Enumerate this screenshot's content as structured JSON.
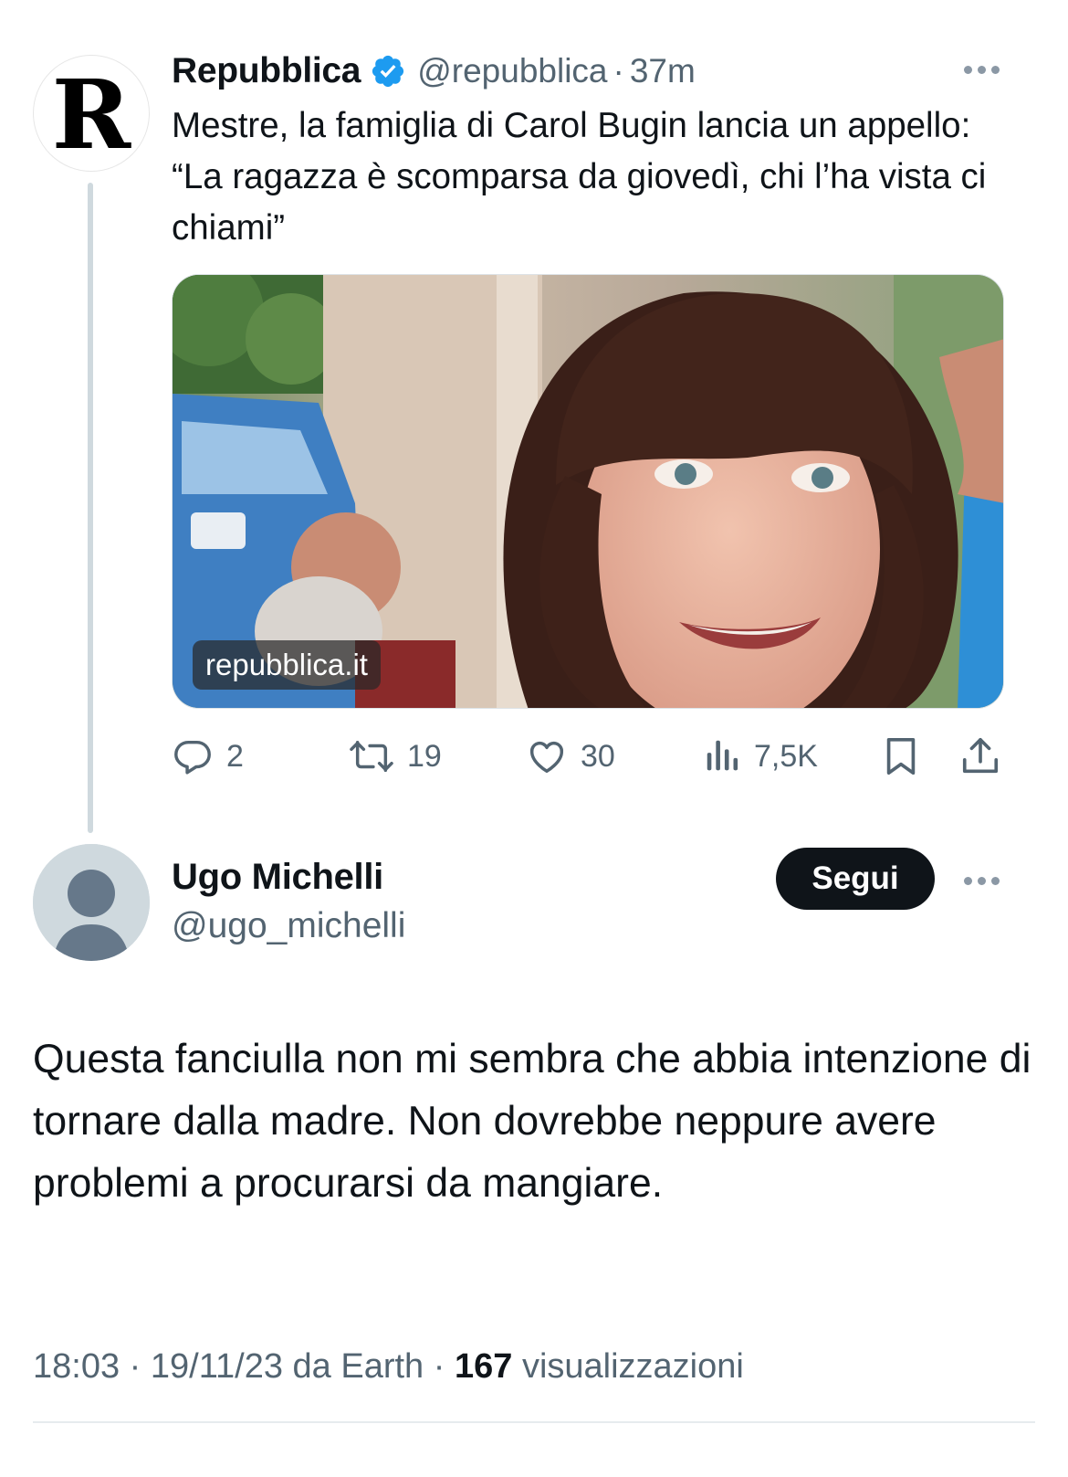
{
  "parent_tweet": {
    "avatar_letter": "R",
    "author_name": "Repubblica",
    "handle": "@repubblica",
    "separator": "·",
    "time": "37m",
    "text": "Mestre, la famiglia di Carol Bugin lancia un appello: “La ragazza è scomparsa da giovedì, chi l’ha vista ci chiami”",
    "media_source": "repubblica.it",
    "stats": {
      "replies": "2",
      "retweets": "19",
      "likes": "30",
      "views": "7,5K"
    }
  },
  "reply_tweet": {
    "author_name": "Ugo Michelli",
    "handle": "@ugo_michelli",
    "follow_label": "Segui",
    "text": "Questa fanciulla non mi sembra che abbia intenzione di tornare dalla madre. Non dovrebbe neppure avere problemi a procurarsi da mangiare.",
    "meta": {
      "time": "18:03",
      "separator": "·",
      "date_source": "19/11/23 da Earth",
      "views_count": "167",
      "views_label": "visualizzazioni"
    }
  },
  "colors": {
    "text": "#0f1419",
    "secondary": "#536471",
    "verified": "#1d9bf0",
    "thread_line": "#cfd9de",
    "follow_button": "#0f1419"
  },
  "icons": [
    "verified-badge-icon",
    "more-icon",
    "reply-icon",
    "retweet-icon",
    "like-icon",
    "views-icon",
    "bookmark-icon",
    "share-icon",
    "default-avatar-icon"
  ]
}
